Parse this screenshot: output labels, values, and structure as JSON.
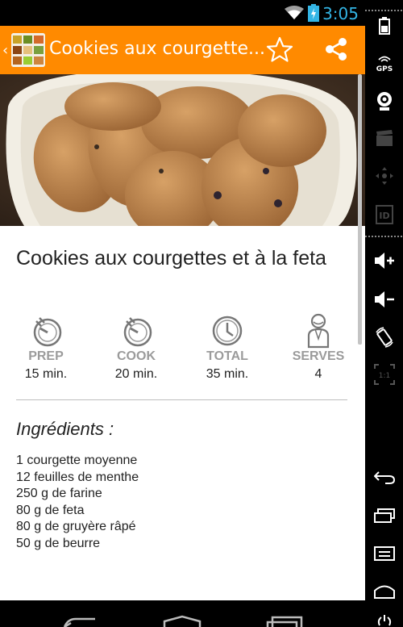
{
  "status_bar": {
    "time": "3:05"
  },
  "action_bar": {
    "title": "Cookies aux courgette...",
    "app_icon": "recipes-app-icon",
    "favorite_icon": "star-outline-icon",
    "share_icon": "share-icon"
  },
  "recipe": {
    "title": "Cookies aux courgettes et à la feta",
    "stats": [
      {
        "label": "PREP",
        "value": "15 min.",
        "icon": "timer-icon"
      },
      {
        "label": "COOK",
        "value": "20 min.",
        "icon": "timer-icon"
      },
      {
        "label": "TOTAL",
        "value": "35 min.",
        "icon": "clock-icon"
      },
      {
        "label": "SERVES",
        "value": "4",
        "icon": "chef-icon"
      }
    ],
    "ingredients_heading": "Ingrédients :",
    "ingredients": [
      "1 courgette moyenne",
      "12 feuilles de menthe",
      "250 g de farine",
      "80 g de feta",
      "80 g de gruyère râpé",
      "50 g de beurre"
    ]
  },
  "emulator_panel": {
    "labels": {
      "gps": "GPS",
      "id": "ID",
      "ratio": "1:1"
    }
  },
  "colors": {
    "accent": "#ff8a00",
    "clock": "#33b5e5"
  }
}
